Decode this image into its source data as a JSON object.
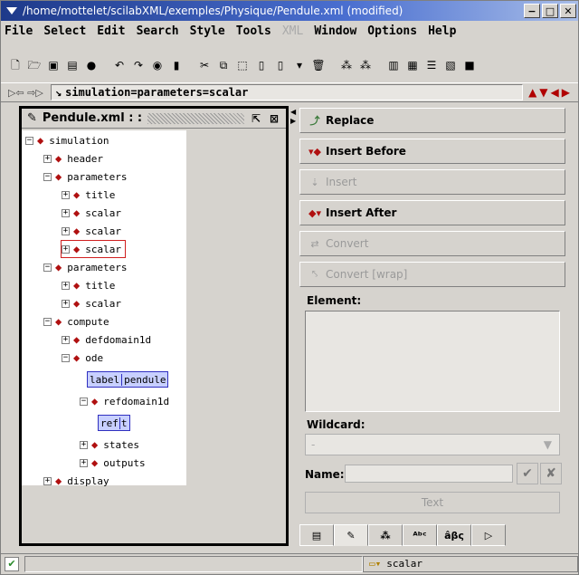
{
  "window": {
    "title": "/home/mottelet/scilabXML/exemples/Physique/Pendule.xml (modified)"
  },
  "menu": [
    "File",
    "Select",
    "Edit",
    "Search",
    "Style",
    "Tools",
    "XML",
    "Window",
    "Options",
    "Help"
  ],
  "path": {
    "value": "simulation=parameters=scalar"
  },
  "tree_panel": {
    "title": "Pendule.xml : :"
  },
  "tree": [
    {
      "label": "simulation"
    },
    {
      "label": "header"
    },
    {
      "label": "parameters"
    },
    {
      "label": "title"
    },
    {
      "label": "scalar"
    },
    {
      "label": "scalar"
    },
    {
      "label": "scalar"
    },
    {
      "label": "parameters"
    },
    {
      "label": "title"
    },
    {
      "label": "scalar"
    },
    {
      "label": "compute"
    },
    {
      "label": "defdomain1d"
    },
    {
      "label": "ode"
    },
    {
      "label": "label",
      "value": "pendule"
    },
    {
      "label": "refdomain1d"
    },
    {
      "label": "ref",
      "value": "t"
    },
    {
      "label": "states"
    },
    {
      "label": "outputs"
    },
    {
      "label": "display"
    }
  ],
  "actions": {
    "replace": "Replace",
    "insert_before": "Insert Before",
    "insert": "Insert",
    "insert_after": "Insert After",
    "convert": "Convert",
    "convert_wrap": "Convert [wrap]"
  },
  "element_panel": {
    "element_label": "Element:",
    "wildcard_label": "Wildcard:",
    "wildcard_value": "-",
    "name_label": "Name:",
    "text_button": "Text"
  },
  "status": {
    "selection": "scalar"
  }
}
